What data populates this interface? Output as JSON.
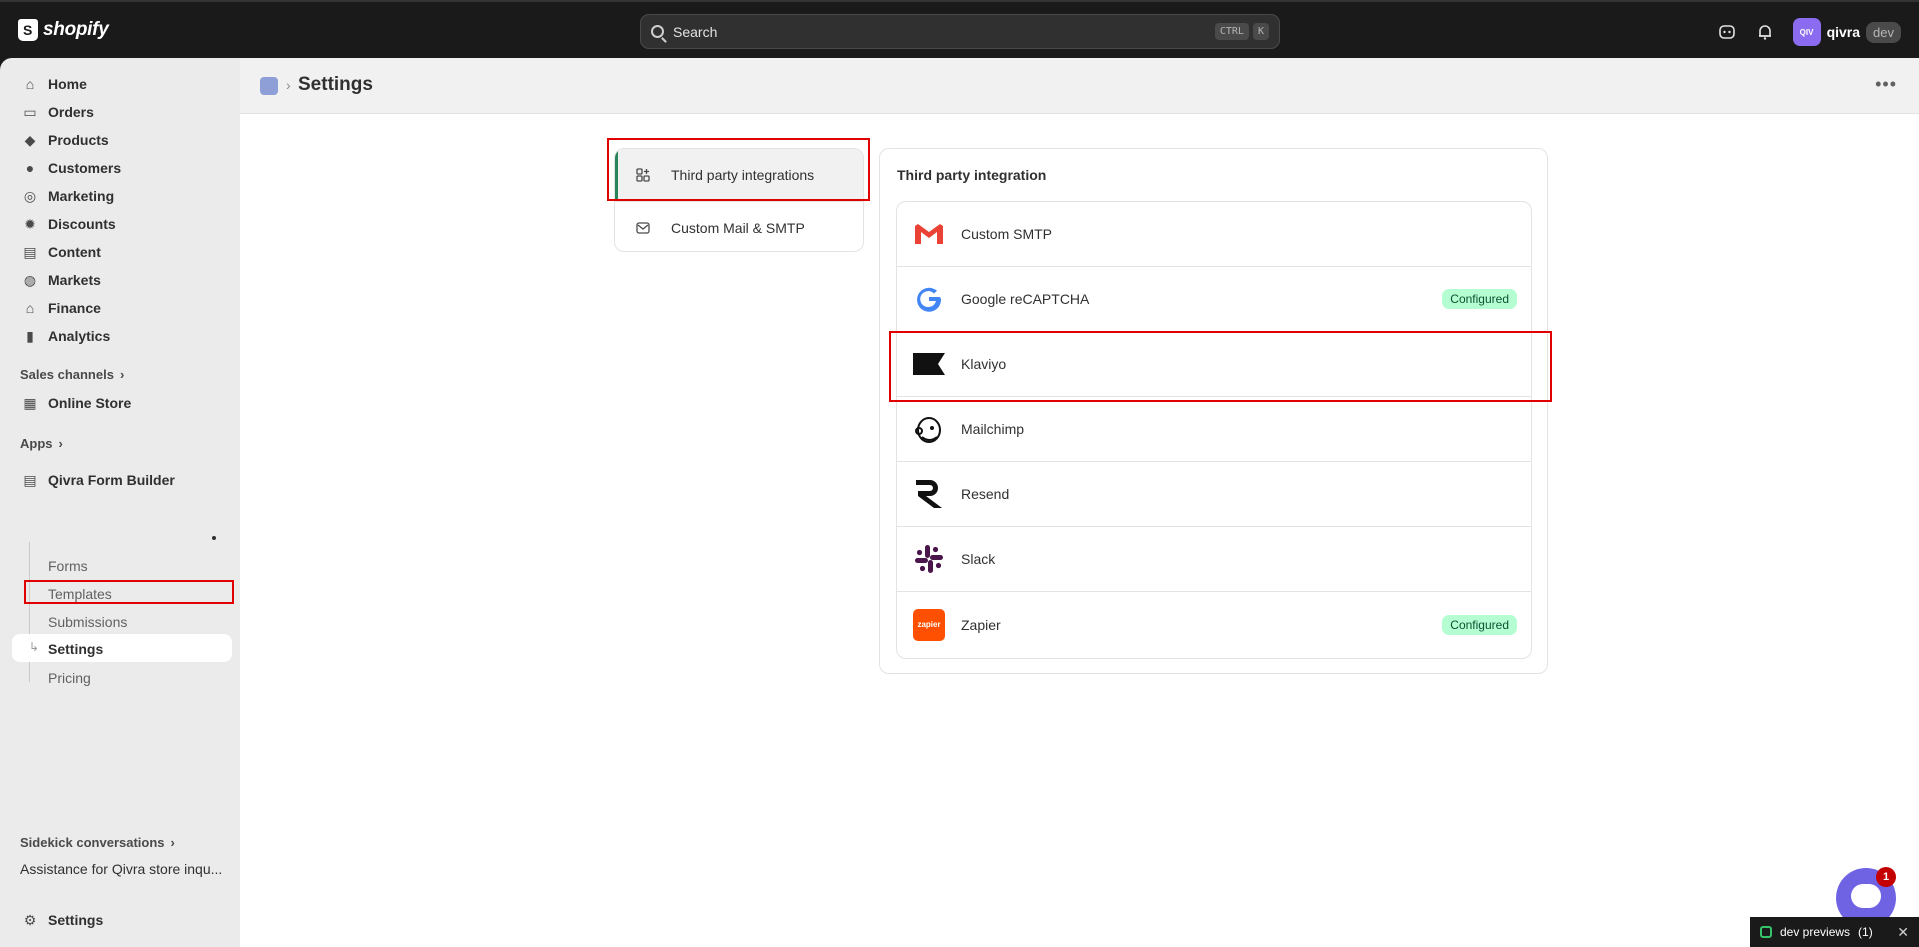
{
  "topbar": {
    "brand": "shopify",
    "search_placeholder": "Search",
    "shortcut_keys": [
      "CTRL",
      "K"
    ],
    "avatar_initials": "QIV",
    "store_name": "qivra",
    "store_tag": "dev"
  },
  "sidebar": {
    "items": [
      {
        "label": "Home",
        "icon": "home-icon"
      },
      {
        "label": "Orders",
        "icon": "inbox-icon"
      },
      {
        "label": "Products",
        "icon": "tag-icon"
      },
      {
        "label": "Customers",
        "icon": "person-icon"
      },
      {
        "label": "Marketing",
        "icon": "target-icon"
      },
      {
        "label": "Discounts",
        "icon": "discount-icon"
      },
      {
        "label": "Content",
        "icon": "content-icon"
      },
      {
        "label": "Markets",
        "icon": "globe-icon"
      },
      {
        "label": "Finance",
        "icon": "bank-icon"
      },
      {
        "label": "Analytics",
        "icon": "chart-icon"
      }
    ],
    "sales_channels_label": "Sales channels",
    "online_store_label": "Online Store",
    "apps_label": "Apps",
    "app_name": "Qivra Form Builder",
    "app_subitems": [
      "Forms",
      "Templates",
      "Submissions",
      "Settings",
      "Pricing"
    ],
    "sidekick_label": "Sidekick conversations",
    "sidekick_item": "Assistance for Qivra store inqu...",
    "settings_label": "Settings"
  },
  "header": {
    "title": "Settings"
  },
  "tabs": [
    {
      "label": "Third party integrations",
      "active": true
    },
    {
      "label": "Custom Mail & SMTP",
      "active": false
    }
  ],
  "integrations": {
    "title": "Third party integration",
    "items": [
      {
        "name": "Custom SMTP",
        "logo": "gmail-logo-icon",
        "status": ""
      },
      {
        "name": "Google reCAPTCHA",
        "logo": "google-logo-icon",
        "status": "Configured"
      },
      {
        "name": "Klaviyo",
        "logo": "klaviyo-logo-icon",
        "status": ""
      },
      {
        "name": "Mailchimp",
        "logo": "mailchimp-logo-icon",
        "status": ""
      },
      {
        "name": "Resend",
        "logo": "resend-logo-icon",
        "status": ""
      },
      {
        "name": "Slack",
        "logo": "slack-logo-icon",
        "status": ""
      },
      {
        "name": "Zapier",
        "logo": "zapier-logo-icon",
        "status": "Configured"
      }
    ],
    "zapier_logo_text": "zapier"
  },
  "chat": {
    "unread": "1"
  },
  "dev_bar": {
    "label": "dev previews",
    "count": "(1)"
  }
}
